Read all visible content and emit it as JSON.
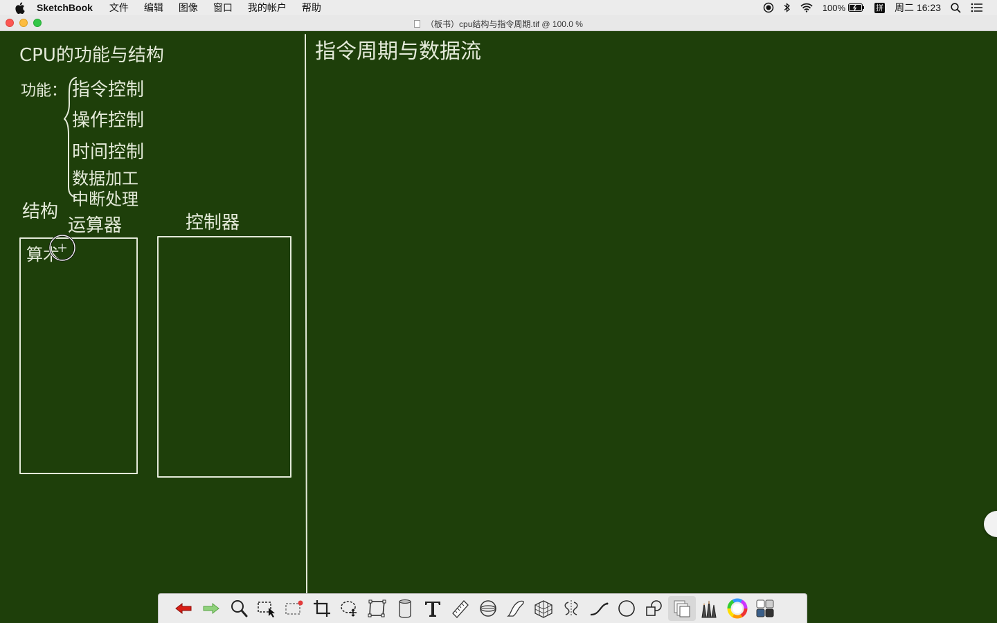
{
  "menubar": {
    "app_name": "SketchBook",
    "items": [
      "文件",
      "编辑",
      "图像",
      "窗口",
      "我的帐户",
      "帮助"
    ],
    "battery": "100%",
    "input_method": "拼",
    "clock": "周二 16:23"
  },
  "window": {
    "title": "（板书）cpu结构与指令周期.tif @ 100.0 %"
  },
  "canvas": {
    "handwriting": {
      "heading_left": "CPU的功能与结构",
      "function_label": "功能：",
      "functions": [
        "指令控制",
        "操作控制",
        "时间控制",
        "数据加工",
        "中断处理"
      ],
      "structure_label": "结构",
      "alu_label": "运算器",
      "alu_inner": "算术",
      "controller_label": "控制器",
      "heading_right": "指令周期与数据流"
    },
    "background_color": "#1e3f0a",
    "chalk_color": "#e4ead9"
  },
  "toolbar": {
    "tools": [
      {
        "name": "undo-icon",
        "label": "撤销"
      },
      {
        "name": "redo-icon",
        "label": "重做"
      },
      {
        "name": "zoom-icon",
        "label": "缩放"
      },
      {
        "name": "select-icon",
        "label": "选择"
      },
      {
        "name": "select-deselect-icon",
        "label": "取消选择"
      },
      {
        "name": "crop-icon",
        "label": "裁剪"
      },
      {
        "name": "lasso-move-icon",
        "label": "变换"
      },
      {
        "name": "distort-icon",
        "label": "扭曲"
      },
      {
        "name": "fill-bucket-icon",
        "label": "填充"
      },
      {
        "name": "text-icon",
        "label": "文本"
      },
      {
        "name": "ruler-icon",
        "label": "标尺"
      },
      {
        "name": "ellipse-guide-icon",
        "label": "椭圆"
      },
      {
        "name": "french-curve-icon",
        "label": "曲线尺"
      },
      {
        "name": "perspective-icon",
        "label": "透视"
      },
      {
        "name": "symmetry-icon",
        "label": "对称"
      },
      {
        "name": "stroke-line-icon",
        "label": "直线"
      },
      {
        "name": "circle-shape-icon",
        "label": "圆形"
      },
      {
        "name": "shapes-icon",
        "label": "形状"
      },
      {
        "name": "layers-icon",
        "label": "图层"
      },
      {
        "name": "brushes-icon",
        "label": "画笔"
      },
      {
        "name": "color-wheel-icon",
        "label": "颜色"
      },
      {
        "name": "palette-grid-icon",
        "label": "色板"
      }
    ]
  }
}
